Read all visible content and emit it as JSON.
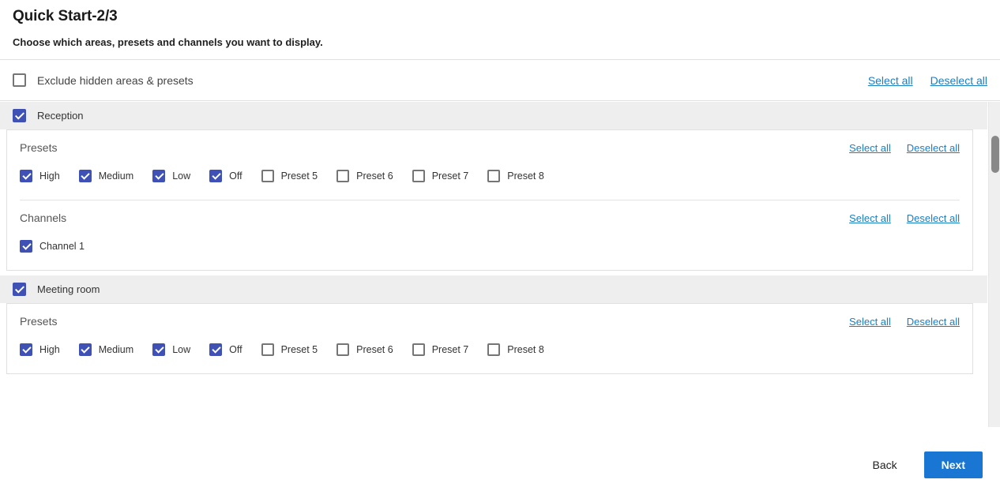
{
  "header": {
    "title": "Quick Start-2/3",
    "subtitle": "Choose which areas, presets and channels you want to display."
  },
  "toolbar": {
    "exclude_label": "Exclude hidden areas & presets",
    "exclude_checked": false,
    "select_all_label": "Select all",
    "deselect_all_label": "Deselect all"
  },
  "labels": {
    "presets_title": "Presets",
    "channels_title": "Channels",
    "select_all_label": "Select all",
    "deselect_all_label": "Deselect all"
  },
  "areas": [
    {
      "name": "Reception",
      "checked": true,
      "presets": [
        {
          "label": "High",
          "checked": true
        },
        {
          "label": "Medium",
          "checked": true
        },
        {
          "label": "Low",
          "checked": true
        },
        {
          "label": "Off",
          "checked": true
        },
        {
          "label": "Preset 5",
          "checked": false
        },
        {
          "label": "Preset 6",
          "checked": false
        },
        {
          "label": "Preset 7",
          "checked": false
        },
        {
          "label": "Preset 8",
          "checked": false
        }
      ],
      "channels": [
        {
          "label": "Channel 1",
          "checked": true
        }
      ]
    },
    {
      "name": "Meeting room",
      "checked": true,
      "presets": [
        {
          "label": "High",
          "checked": true
        },
        {
          "label": "Medium",
          "checked": true
        },
        {
          "label": "Low",
          "checked": true
        },
        {
          "label": "Off",
          "checked": true
        },
        {
          "label": "Preset 5",
          "checked": false
        },
        {
          "label": "Preset 6",
          "checked": false
        },
        {
          "label": "Preset 7",
          "checked": false
        },
        {
          "label": "Preset 8",
          "checked": false
        }
      ],
      "channels": []
    }
  ],
  "footer": {
    "back_label": "Back",
    "next_label": "Next"
  },
  "colors": {
    "checkbox_accent": "#3f51b5",
    "link": "#1a7fc1",
    "primary_button": "#1976d2",
    "area_row_bg": "#eeeeee"
  }
}
